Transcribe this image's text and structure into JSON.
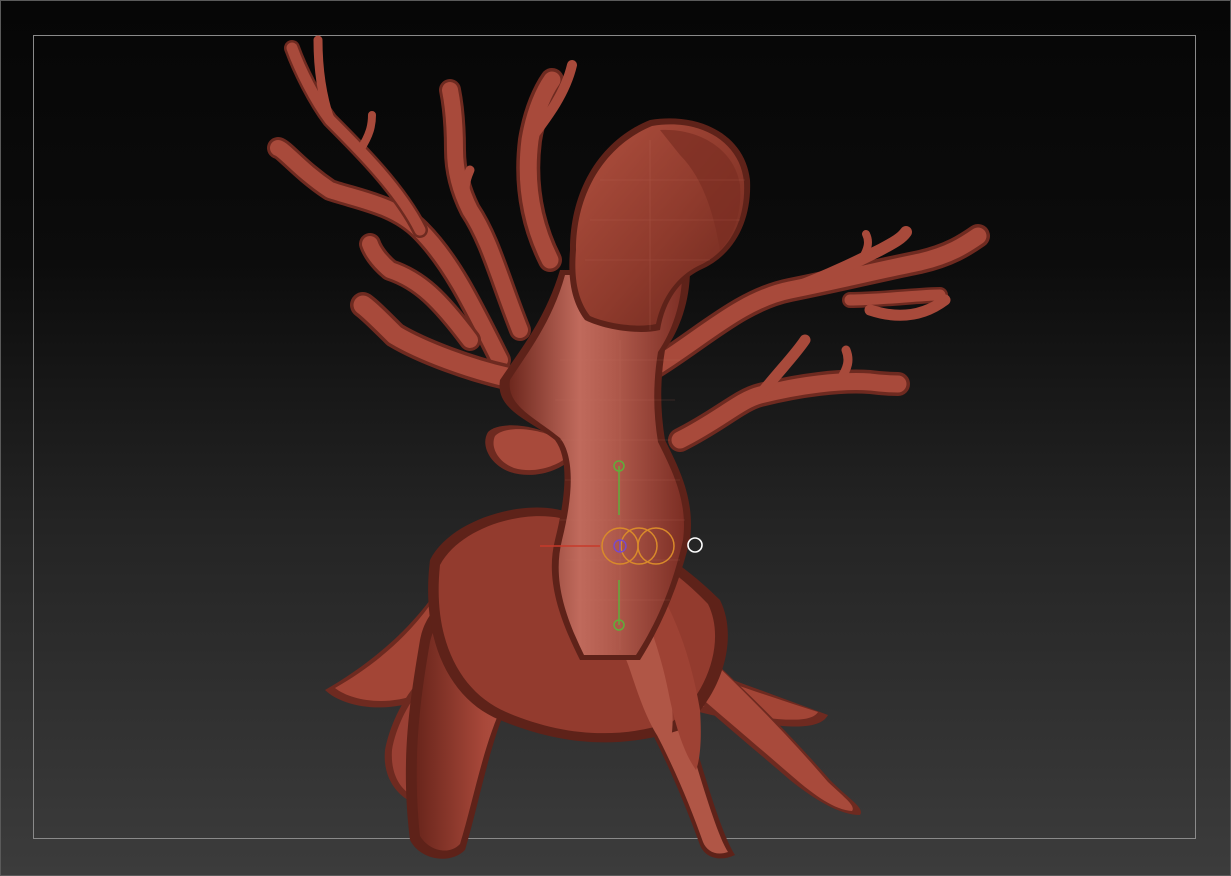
{
  "viewport": {
    "title": "",
    "model": {
      "name": "",
      "material_color": "#9e4234",
      "highlight_color": "#c46656",
      "shadow_color": "#5e2219"
    },
    "gizmo": {
      "ring_color": "#d98a2a",
      "axis_y_color": "#5fae3a",
      "axis_x_color": "#c83a2a",
      "center_color": "#7a4ac8",
      "cursor_color": "#ffffff"
    },
    "frame_color": "#8a8a8a"
  }
}
